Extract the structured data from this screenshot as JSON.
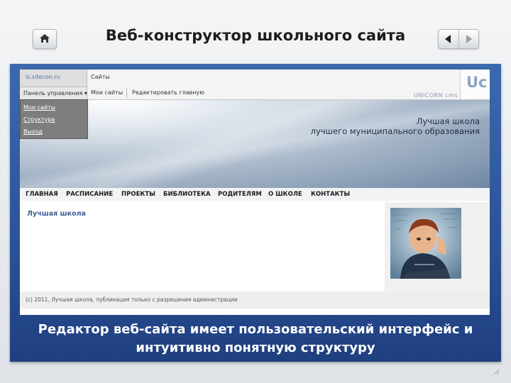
{
  "slide": {
    "title": "Веб-конструктор школьного сайта",
    "caption_line1": "Редактор веб-сайта имеет пользовательский интерфейс и",
    "caption_line2": "интуитивно понятную структуру",
    "icons": {
      "home": "home-icon",
      "prev": "arrow-left-icon",
      "next": "arrow-right-icon"
    }
  },
  "admin": {
    "site_domain": "ls.sitecon.ru",
    "panel_label": "Панель управления ▾",
    "sites_title": "Сайты",
    "links": [
      "Мои сайты",
      "Редактировать главную"
    ],
    "cms_name": "UNICORN cms",
    "logo_text": "Uc",
    "dropdown": [
      "Мои сайты",
      "Структура",
      "Выход"
    ]
  },
  "site": {
    "header_line1": "Лучшая школа",
    "header_line2": "лучшего муниципального образования",
    "menu": [
      "ГЛАВНАЯ",
      "РАСПИСАНИЕ",
      "ПРОЕКТЫ",
      "БИБЛИОТЕКА",
      "РОДИТЕЛЯМ",
      "О ШКОЛЕ",
      "КОНТАКТЫ"
    ],
    "content_title": "Лучшая школа",
    "footer": "(c) 2011, Лучшая школа, публикация только с разрешения администрации"
  },
  "colors": {
    "panel_blue": "#2b5397",
    "link_blue": "#3e5f97"
  }
}
